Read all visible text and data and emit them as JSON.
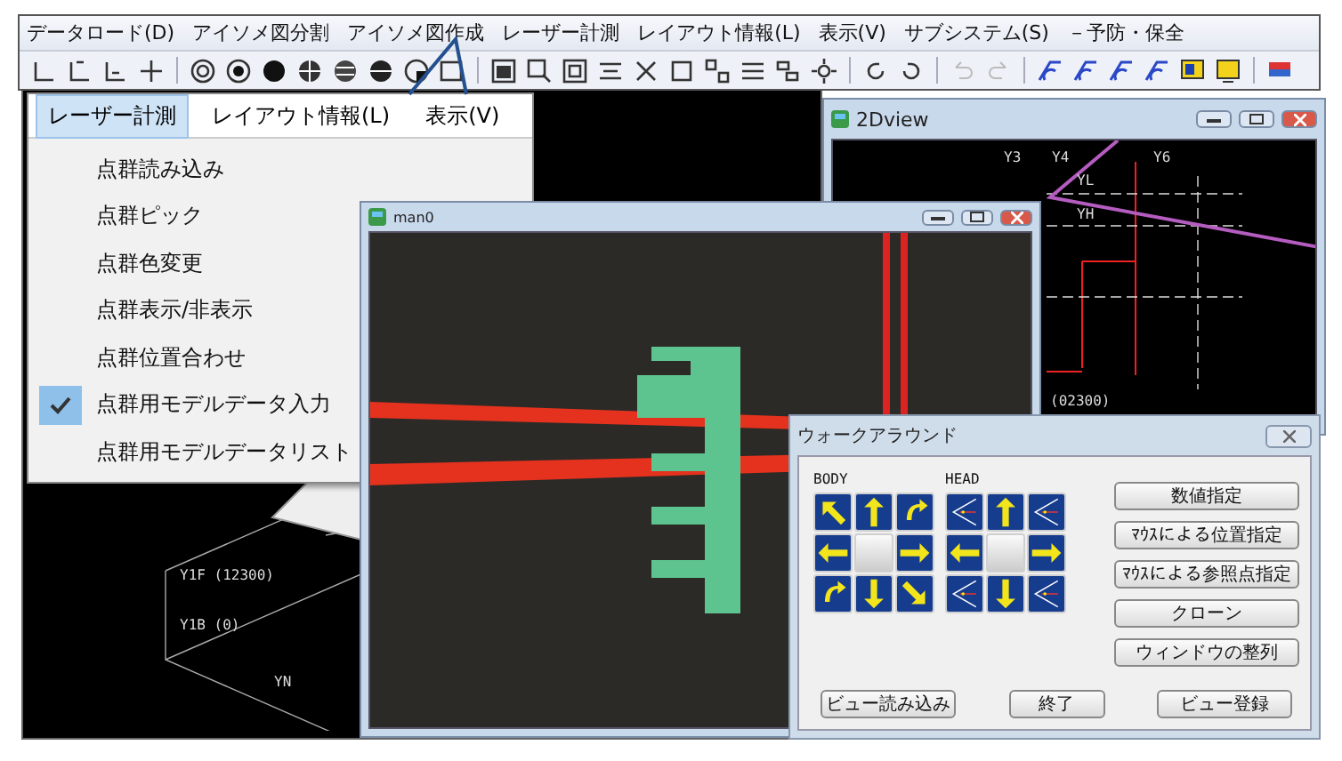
{
  "menubar": {
    "items": [
      "データロード(D)",
      "アイソメ図分割",
      "アイソメ図作成",
      "レーザー計測",
      "レイアウト情報(L)",
      "表示(V)",
      "サブシステム(S)",
      "－予防・保全"
    ]
  },
  "menu": {
    "tabs": [
      {
        "label": "レーザー計測",
        "selected": true
      },
      {
        "label": "レイアウト情報(L)",
        "selected": false
      },
      {
        "label": "表示(V)",
        "selected": false
      }
    ],
    "items": [
      {
        "label": "点群読み込み",
        "checked": false
      },
      {
        "label": "点群ピック",
        "checked": false
      },
      {
        "label": "点群色変更",
        "checked": false
      },
      {
        "label": "点群表示/非表示",
        "checked": false
      },
      {
        "label": "点群位置合わせ",
        "checked": false
      },
      {
        "label": "点群用モデルデータ入力",
        "checked": true
      },
      {
        "label": "点群用モデルデータリスト",
        "checked": false
      }
    ]
  },
  "cad_view": {
    "labels": [
      "Y1F (12300)",
      "Y1B (0)",
      "YN"
    ]
  },
  "view_2d": {
    "title": "2Dview",
    "labels": [
      "Y3",
      "Y4",
      "Y6",
      "YL",
      "YH",
      "(02300)"
    ]
  },
  "view_3d": {
    "title": "man0"
  },
  "walkaround": {
    "title": "ウォークアラウンド",
    "body_label": "BODY",
    "head_label": "HEAD",
    "side_buttons": [
      "数値指定",
      "ﾏｳｽによる位置指定",
      "ﾏｳｽによる参照点指定",
      "クローン",
      "ウィンドウの整列"
    ],
    "bottom_buttons": [
      "ビュー読み込み",
      "終了",
      "ビュー登録"
    ]
  }
}
